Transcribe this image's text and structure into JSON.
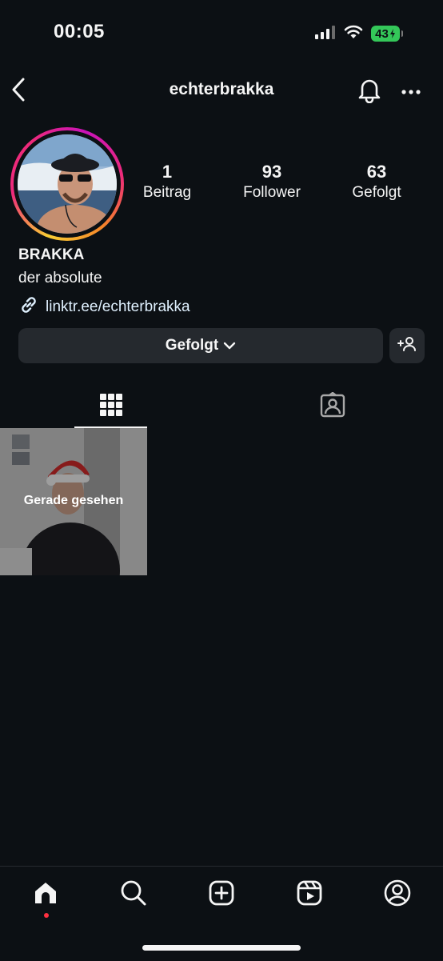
{
  "status_bar": {
    "time": "00:05",
    "battery": "43",
    "icons": [
      "signal-icon",
      "wifi-icon",
      "battery-icon"
    ]
  },
  "header": {
    "username": "echterbrakka",
    "icons": [
      "back-icon",
      "bell-icon",
      "more-icon"
    ]
  },
  "profile": {
    "stats": [
      {
        "value": "1",
        "label": "Beitrag"
      },
      {
        "value": "93",
        "label": "Follower"
      },
      {
        "value": "63",
        "label": "Gefolgt"
      }
    ],
    "name": "BRAKKA",
    "bio": "der absolute",
    "link": "linktr.ee/echterbrakka"
  },
  "actions": {
    "follow_label": "Gefolgt",
    "add_user_icon": "add-user-icon"
  },
  "tabs": [
    {
      "icon": "grid-icon",
      "active": true
    },
    {
      "icon": "tagged-icon",
      "active": false
    }
  ],
  "posts": [
    {
      "overlay_label": "Gerade gesehen"
    }
  ],
  "bottom_nav": [
    {
      "icon": "home-icon",
      "active": true
    },
    {
      "icon": "search-icon"
    },
    {
      "icon": "create-icon"
    },
    {
      "icon": "reels-icon"
    },
    {
      "icon": "profile-icon"
    }
  ],
  "colors": {
    "background": "#0c1014",
    "button": "#25292e",
    "link": "#e0f1ff",
    "battery": "#34c759",
    "notification_dot": "#ff3040"
  }
}
